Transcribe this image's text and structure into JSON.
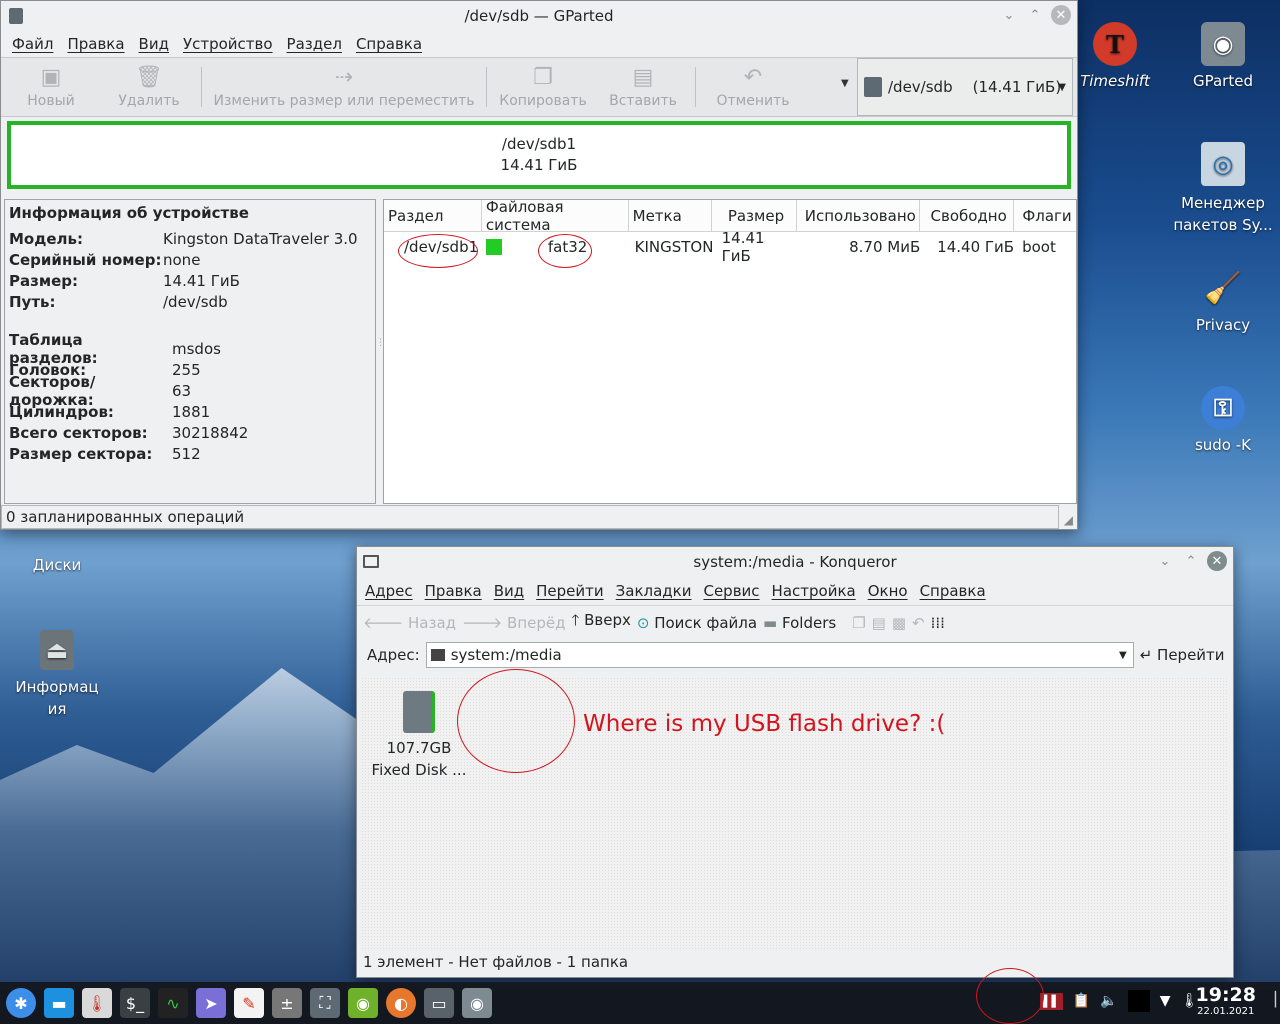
{
  "desktop": {
    "icons": [
      {
        "label": "Timeshift"
      },
      {
        "label": "GParted"
      },
      {
        "label": "Менеджер пакетов Sy..."
      },
      {
        "label": "Privacy"
      },
      {
        "label": "sudo -K"
      },
      {
        "label": "Диски"
      },
      {
        "label": "Информация"
      }
    ]
  },
  "gparted": {
    "title": "/dev/sdb — GParted",
    "menu": [
      "Файл",
      "Правка",
      "Вид",
      "Устройство",
      "Раздел",
      "Справка"
    ],
    "toolbar": {
      "new": "Новый",
      "delete": "Удалить",
      "resize": "Изменить размер или переместить",
      "copy": "Копировать",
      "paste": "Вставить",
      "undo": "Отменить"
    },
    "device_selector": {
      "device": "/dev/sdb",
      "size": "(14.41 ГиБ)"
    },
    "partition_bar": {
      "name": "/dev/sdb1",
      "size": "14.41 ГиБ"
    },
    "device_info": {
      "heading": "Информация об устройстве",
      "rows": [
        {
          "key": "Модель:",
          "value": "Kingston DataTraveler 3.0"
        },
        {
          "key": "Серийный номер:",
          "value": "none"
        },
        {
          "key": "Размер:",
          "value": "14.41 ГиБ"
        },
        {
          "key": "Путь:",
          "value": "/dev/sdb"
        }
      ],
      "rows2": [
        {
          "key": "Таблица разделов:",
          "value": "msdos"
        },
        {
          "key": "Головок:",
          "value": "255"
        },
        {
          "key": "Секторов/дорожка:",
          "value": "63"
        },
        {
          "key": "Цилиндров:",
          "value": "1881"
        },
        {
          "key": "Всего секторов:",
          "value": "30218842"
        },
        {
          "key": "Размер сектора:",
          "value": "512"
        }
      ]
    },
    "partitions": {
      "columns": [
        "Раздел",
        "Файловая система",
        "Метка",
        "Размер",
        "Использовано",
        "Свободно",
        "Флаги"
      ],
      "rows": [
        {
          "partition": "/dev/sdb1",
          "fs": "fat32",
          "fs_color": "#22cc22",
          "label": "KINGSTON",
          "size": "14.41 ГиБ",
          "used": "8.70 МиБ",
          "free": "14.40 ГиБ",
          "flags": "boot"
        }
      ]
    },
    "status": "0 запланированных операций"
  },
  "konqueror": {
    "title": "system:/media - Konqueror",
    "menu": [
      "Адрес",
      "Правка",
      "Вид",
      "Перейти",
      "Закладки",
      "Сервис",
      "Настройка",
      "Окно",
      "Справка"
    ],
    "toolbar": {
      "back": "Назад",
      "forward": "Вперёд",
      "up": "Вверх",
      "find": "Поиск файла",
      "folders": "Folders"
    },
    "address_label": "Адрес:",
    "address_value": "system:/media",
    "go_label": "Перейти",
    "items": [
      {
        "line1": "107.7GB",
        "line2": "Fixed Disk ..."
      }
    ],
    "annotation": "Where is my USB flash drive? :(",
    "status": "1 элемент - Нет файлов - 1 папка"
  },
  "taskbar": {
    "time": "19:28",
    "date": "22.01.2021"
  },
  "colors": {
    "annotation_red": "#d2141e",
    "partition_green": "#26b326"
  }
}
